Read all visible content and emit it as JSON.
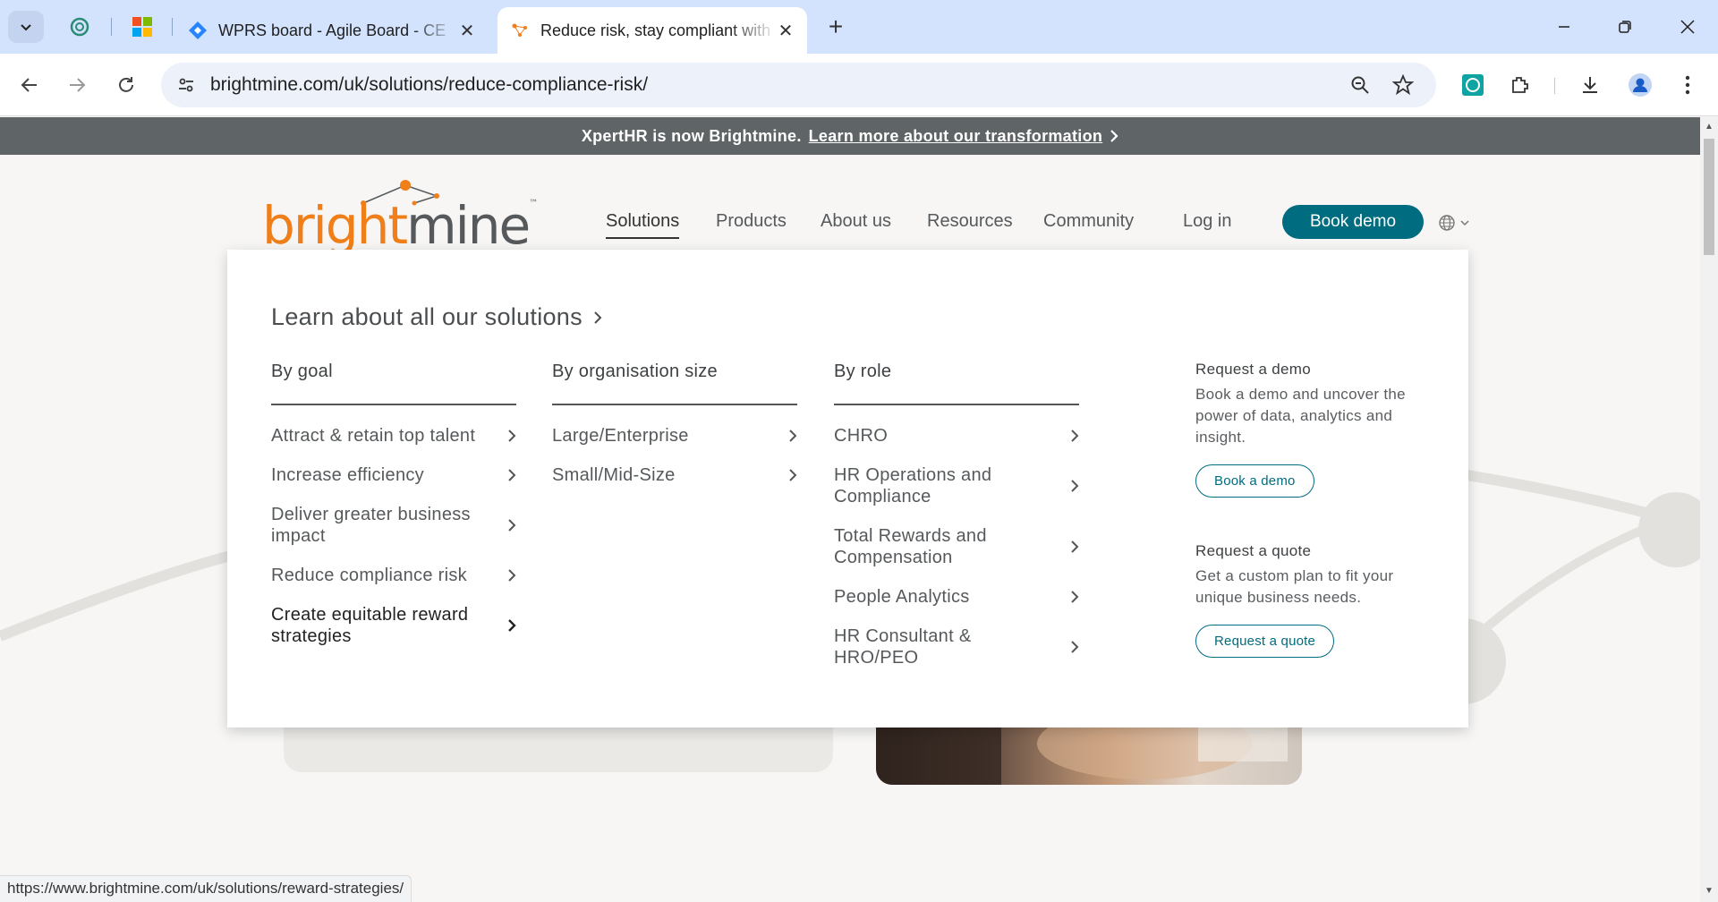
{
  "browser": {
    "tabs": [
      {
        "title": "WPRS board - Agile Board - CE",
        "icon": "jira-diamond-icon"
      },
      {
        "title": "Reduce risk, stay compliant with",
        "icon": "brightmine-favicon-icon",
        "active": true
      }
    ],
    "url": "brightmine.com/uk/solutions/reduce-compliance-risk/",
    "status_url": "https://www.brightmine.com/uk/solutions/reward-strategies/"
  },
  "banner": {
    "text": "XpertHR is now Brightmine.",
    "link": "Learn more about our transformation"
  },
  "logo": {
    "part1": "bright",
    "part2": "mine",
    "tm": "™"
  },
  "nav": {
    "items": [
      "Solutions",
      "Products",
      "About us",
      "Resources",
      "Community"
    ],
    "login": "Log in",
    "book_demo": "Book demo"
  },
  "mega": {
    "title": "Learn about all our solutions",
    "by_goal": {
      "heading": "By goal",
      "items": [
        "Attract & retain top talent",
        "Increase efficiency",
        "Deliver greater business impact",
        "Reduce compliance risk",
        "Create equitable reward strategies"
      ]
    },
    "by_size": {
      "heading": "By organisation size",
      "items": [
        "Large/Enterprise",
        "Small/Mid-Size"
      ]
    },
    "by_role": {
      "heading": "By role",
      "items": [
        "CHRO",
        "HR Operations and Compliance",
        "Total Rewards and Compensation",
        "People Analytics",
        "HR Consultant & HRO/PEO"
      ]
    },
    "demo": {
      "heading": "Request a demo",
      "text": "Book a demo and uncover the power of data, analytics and insight.",
      "button": "Book a demo"
    },
    "quote": {
      "heading": "Request a quote",
      "text": "Get a custom plan to fit your unique business needs.",
      "button": "Request a quote"
    }
  },
  "colors": {
    "brand_orange": "#f07f1a",
    "brand_teal": "#006c7f",
    "banner_bg": "#5f6567"
  }
}
